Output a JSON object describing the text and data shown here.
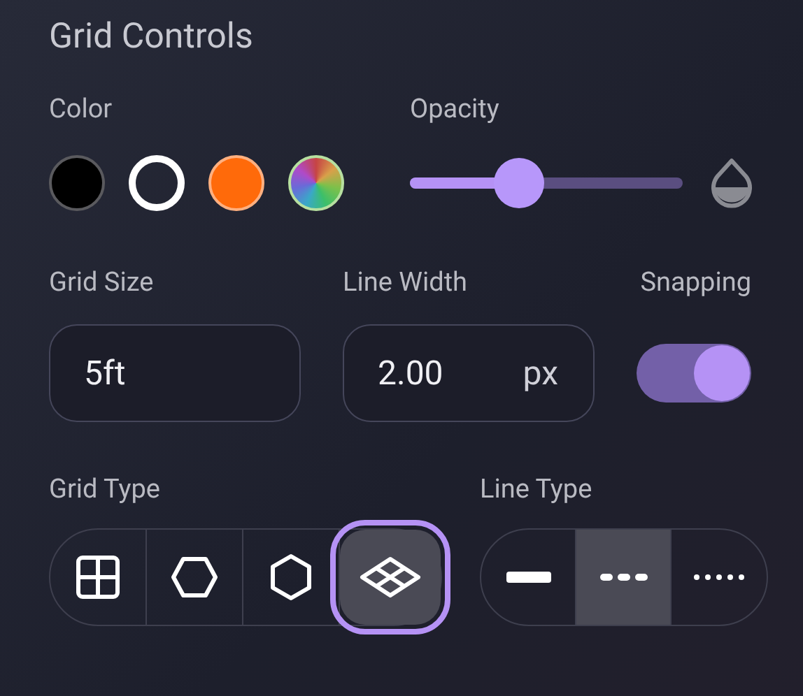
{
  "title": "Grid Controls",
  "color": {
    "label": "Color",
    "swatches": [
      {
        "color": "#000000",
        "selected": false,
        "kind": "solid"
      },
      {
        "color": "#ffffff",
        "selected": true,
        "kind": "solid"
      },
      {
        "color": "#ff6a0a",
        "selected": false,
        "kind": "solid"
      },
      {
        "selected": false,
        "kind": "rainbow"
      }
    ]
  },
  "opacity": {
    "label": "Opacity",
    "level": 0.4
  },
  "grid_size": {
    "label": "Grid Size",
    "value": "5ft"
  },
  "line_width": {
    "label": "Line Width",
    "value": "2.00",
    "unit": "px"
  },
  "snapping": {
    "label": "Snapping",
    "on": true
  },
  "grid_type": {
    "label": "Grid Type",
    "options": [
      {
        "kind": "square",
        "selected": false
      },
      {
        "kind": "hex-flat",
        "selected": false
      },
      {
        "kind": "hex-pointy",
        "selected": false
      },
      {
        "kind": "isometric",
        "selected": true
      }
    ]
  },
  "line_type": {
    "label": "Line Type",
    "options": [
      {
        "kind": "solid",
        "selected": false
      },
      {
        "kind": "dashed",
        "selected": true
      },
      {
        "kind": "dotted",
        "selected": false
      }
    ]
  }
}
